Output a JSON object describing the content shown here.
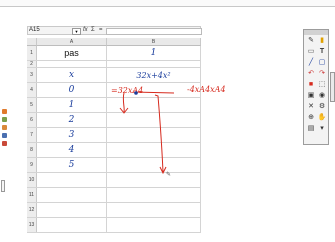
{
  "window": {
    "title": ""
  },
  "formula_bar": {
    "cell_ref": "A15",
    "fx": "fx",
    "sigma": "Σ",
    "equals": "="
  },
  "columns": {
    "a": "A",
    "b": "B"
  },
  "rows": [
    {
      "num": "1",
      "a": "pas",
      "b": "1"
    },
    {
      "num": "2",
      "a": "",
      "b": ""
    },
    {
      "num": "3",
      "a": "x",
      "b": "32x+4x²"
    },
    {
      "num": "4",
      "a": "0",
      "b": "=32xA4"
    },
    {
      "num": "5",
      "a": "1",
      "b": ""
    },
    {
      "num": "6",
      "a": "2",
      "b": ""
    },
    {
      "num": "7",
      "a": "3",
      "b": ""
    },
    {
      "num": "8",
      "a": "4",
      "b": ""
    },
    {
      "num": "9",
      "a": "5",
      "b": ""
    },
    {
      "num": "10",
      "a": "",
      "b": ""
    },
    {
      "num": "11",
      "a": "",
      "b": ""
    },
    {
      "num": "12",
      "a": "",
      "b": ""
    },
    {
      "num": "13",
      "a": "",
      "b": ""
    }
  ],
  "annotations": {
    "formula_extension": "-4xA4xA4"
  },
  "colors": {
    "ink_blue": "#1a3d9c",
    "ink_red": "#d62a1e",
    "grid": "#d4d4d4",
    "header": "#ededed"
  },
  "palette": {
    "icons": [
      "pen-icon",
      "highlighter-icon",
      "eraser-icon",
      "text-icon",
      "line-icon",
      "shape-icon",
      "undo-icon",
      "redo-icon",
      "color-swatch-icon",
      "select-icon",
      "screen-icon",
      "camera-icon",
      "clear-icon",
      "settings-icon"
    ]
  }
}
